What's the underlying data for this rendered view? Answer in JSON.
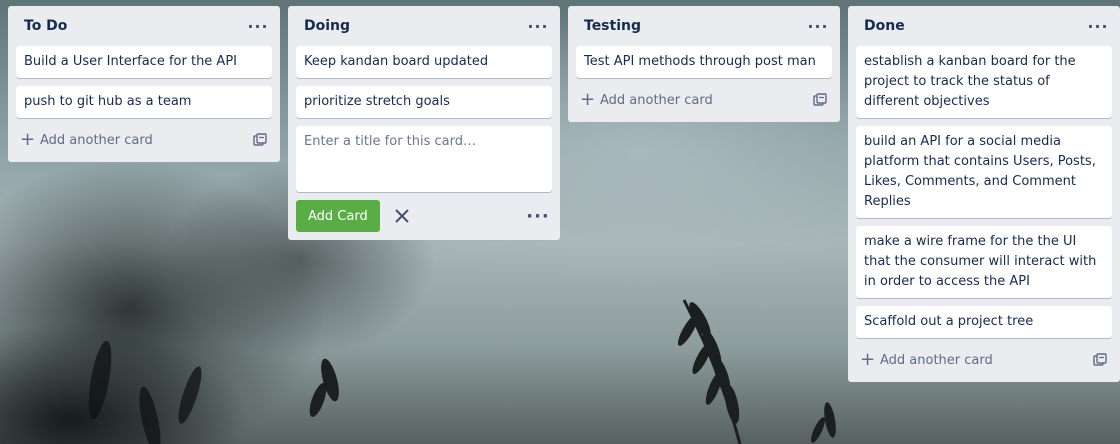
{
  "board": {
    "lists": [
      {
        "title": "To Do",
        "menu_icon": "ellipsis-icon",
        "cards": [
          "Build a User Interface for the API",
          "push to git hub as a team"
        ],
        "add_label": "Add another card"
      },
      {
        "title": "Doing",
        "menu_icon": "ellipsis-icon",
        "cards": [
          "Keep kandan board updated",
          "prioritize stretch goals"
        ],
        "composer": {
          "placeholder": "Enter a title for this card…",
          "add_button": "Add Card"
        }
      },
      {
        "title": "Testing",
        "menu_icon": "ellipsis-icon",
        "cards": [
          "Test API methods through post man"
        ],
        "add_label": "Add another card"
      },
      {
        "title": "Done",
        "menu_icon": "ellipsis-icon",
        "cards": [
          "establish a kanban board for the project to track the status of different objectives",
          "build an API for a social media platform that contains Users, Posts, Likes, Comments, and Comment Replies",
          "make a wire frame for the the UI that the consumer will interact with in order to access the API",
          "Scaffold out a project tree"
        ],
        "add_label": "Add another card"
      }
    ]
  },
  "colors": {
    "list_bg": "#ebecf0",
    "card_bg": "#ffffff",
    "add_button_bg": "#5aac44",
    "text": "#172b4d",
    "muted_text": "#5e6c84"
  },
  "icons": [
    "ellipsis-icon",
    "plus-icon",
    "card-template-icon",
    "close-icon"
  ]
}
